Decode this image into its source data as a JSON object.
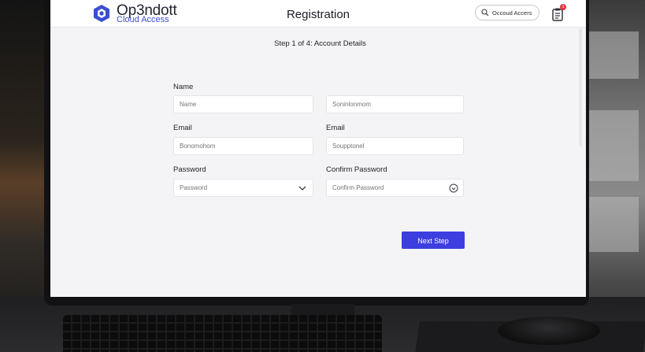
{
  "app": {
    "logo_name": "Op3ndott",
    "logo_sub": "Cloud Access",
    "page_title": "Registration",
    "account_button": "Occoud Accers",
    "notification_count": "3"
  },
  "form": {
    "step_text": "Step 1 of 4: Account Details",
    "fields": [
      {
        "label": "Name",
        "placeholder": "Name"
      },
      {
        "label": "",
        "placeholder": "Soninlonmom"
      },
      {
        "label": "Email",
        "placeholder": "Bonomohom"
      },
      {
        "label": "Email",
        "placeholder": "Soupptonel"
      },
      {
        "label": "Password",
        "placeholder": "Password"
      },
      {
        "label": "Confirm Password",
        "placeholder": "Confirm Password"
      }
    ],
    "next_button": "Next Step"
  },
  "colors": {
    "accent": "#3d3ee0",
    "logo": "#3c4ed0",
    "badge": "#e2323f"
  },
  "icons": {
    "logo": "hexagon-logo-icon",
    "search": "search-icon",
    "notifications": "clipboard-notification-icon",
    "dropdown": "chevron-down-icon",
    "reveal": "eye-toggle-icon"
  }
}
